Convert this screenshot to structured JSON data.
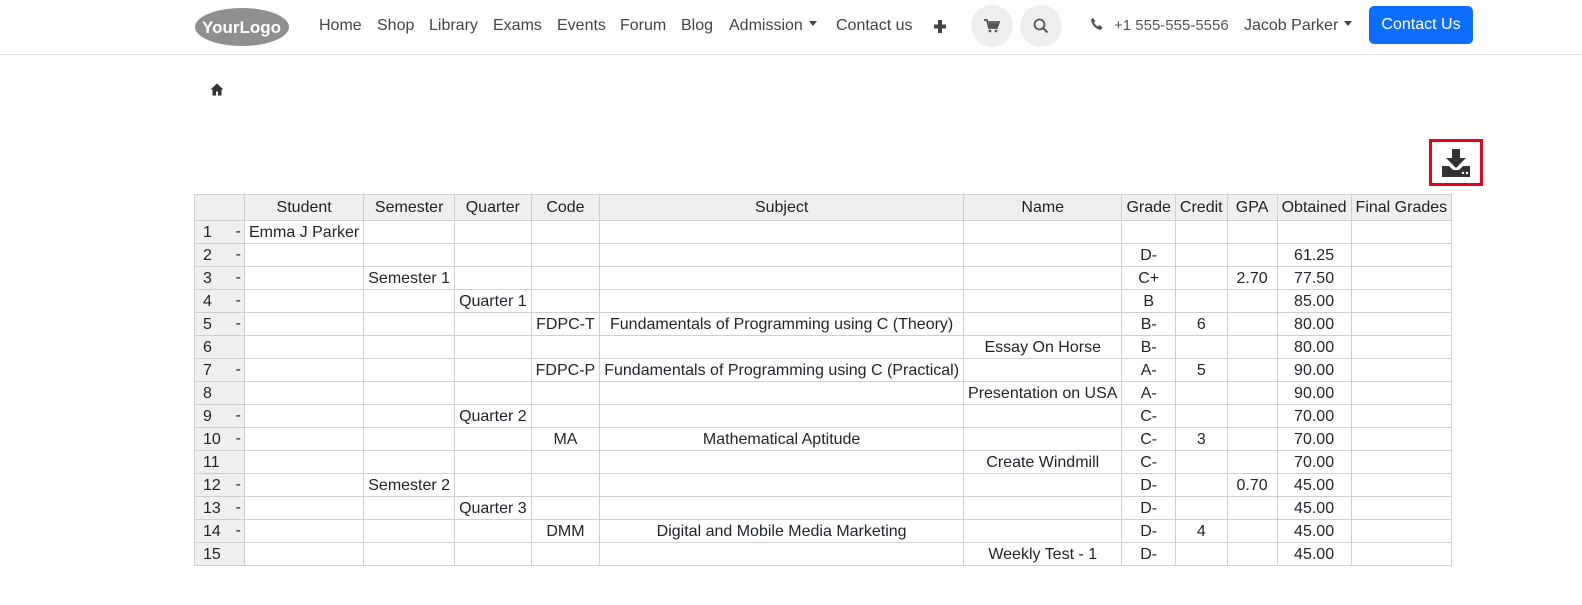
{
  "nav": {
    "logo_text": "YourLogo",
    "links": [
      "Home",
      "Shop",
      "Library",
      "Exams",
      "Events",
      "Forum",
      "Blog",
      "Admission",
      "Contact us"
    ],
    "phone": "+1 555-555-5556",
    "user": "Jacob Parker",
    "cta": "Contact Us"
  },
  "table": {
    "headers": [
      "",
      "Student",
      "Semester",
      "Quarter",
      "Code",
      "Subject",
      "Name",
      "Grade",
      "Credit",
      "GPA",
      "Obtained",
      "Final Grades"
    ],
    "rows": [
      {
        "n": "1",
        "dash": "-",
        "student": "Emma J Parker",
        "semester": "",
        "quarter": "",
        "code": "",
        "subject": "",
        "name": "",
        "grade": "",
        "credit": "",
        "gpa": "",
        "obtained": "",
        "final": ""
      },
      {
        "n": "2",
        "dash": "-",
        "student": "",
        "semester": "",
        "quarter": "",
        "code": "",
        "subject": "",
        "name": "",
        "grade": "D-",
        "credit": "",
        "gpa": "",
        "obtained": "61.25",
        "final": ""
      },
      {
        "n": "3",
        "dash": "-",
        "student": "",
        "semester": "Semester 1",
        "quarter": "",
        "code": "",
        "subject": "",
        "name": "",
        "grade": "C+",
        "credit": "",
        "gpa": "2.70",
        "obtained": "77.50",
        "final": ""
      },
      {
        "n": "4",
        "dash": "-",
        "student": "",
        "semester": "",
        "quarter": "Quarter 1",
        "code": "",
        "subject": "",
        "name": "",
        "grade": "B",
        "credit": "",
        "gpa": "",
        "obtained": "85.00",
        "final": ""
      },
      {
        "n": "5",
        "dash": "-",
        "student": "",
        "semester": "",
        "quarter": "",
        "code": "FDPC-T",
        "subject": "Fundamentals of Programming using C (Theory)",
        "name": "",
        "grade": "B-",
        "credit": "6",
        "gpa": "",
        "obtained": "80.00",
        "final": ""
      },
      {
        "n": "6",
        "dash": "",
        "student": "",
        "semester": "",
        "quarter": "",
        "code": "",
        "subject": "",
        "name": "Essay On Horse",
        "grade": "B-",
        "credit": "",
        "gpa": "",
        "obtained": "80.00",
        "final": ""
      },
      {
        "n": "7",
        "dash": "-",
        "student": "",
        "semester": "",
        "quarter": "",
        "code": "FDPC-P",
        "subject": "Fundamentals of Programming using C (Practical)",
        "name": "",
        "grade": "A-",
        "credit": "5",
        "gpa": "",
        "obtained": "90.00",
        "final": ""
      },
      {
        "n": "8",
        "dash": "",
        "student": "",
        "semester": "",
        "quarter": "",
        "code": "",
        "subject": "",
        "name": "Presentation on USA",
        "grade": "A-",
        "credit": "",
        "gpa": "",
        "obtained": "90.00",
        "final": ""
      },
      {
        "n": "9",
        "dash": "-",
        "student": "",
        "semester": "",
        "quarter": "Quarter 2",
        "code": "",
        "subject": "",
        "name": "",
        "grade": "C-",
        "credit": "",
        "gpa": "",
        "obtained": "70.00",
        "final": ""
      },
      {
        "n": "10",
        "dash": "-",
        "student": "",
        "semester": "",
        "quarter": "",
        "code": "MA",
        "subject": "Mathematical Aptitude",
        "name": "",
        "grade": "C-",
        "credit": "3",
        "gpa": "",
        "obtained": "70.00",
        "final": ""
      },
      {
        "n": "11",
        "dash": "",
        "student": "",
        "semester": "",
        "quarter": "",
        "code": "",
        "subject": "",
        "name": "Create Windmill",
        "grade": "C-",
        "credit": "",
        "gpa": "",
        "obtained": "70.00",
        "final": ""
      },
      {
        "n": "12",
        "dash": "-",
        "student": "",
        "semester": "Semester 2",
        "quarter": "",
        "code": "",
        "subject": "",
        "name": "",
        "grade": "D-",
        "credit": "",
        "gpa": "0.70",
        "obtained": "45.00",
        "final": ""
      },
      {
        "n": "13",
        "dash": "-",
        "student": "",
        "semester": "",
        "quarter": "Quarter 3",
        "code": "",
        "subject": "",
        "name": "",
        "grade": "D-",
        "credit": "",
        "gpa": "",
        "obtained": "45.00",
        "final": ""
      },
      {
        "n": "14",
        "dash": "-",
        "student": "",
        "semester": "",
        "quarter": "",
        "code": "DMM",
        "subject": "Digital and Mobile Media Marketing",
        "name": "",
        "grade": "D-",
        "credit": "4",
        "gpa": "",
        "obtained": "45.00",
        "final": ""
      },
      {
        "n": "15",
        "dash": "",
        "student": "",
        "semester": "",
        "quarter": "",
        "code": "",
        "subject": "",
        "name": "Weekly Test - 1",
        "grade": "D-",
        "credit": "",
        "gpa": "",
        "obtained": "45.00",
        "final": ""
      }
    ]
  },
  "icons": {
    "plus": "plus-icon",
    "cart": "cart-icon",
    "search": "search-icon",
    "phone": "phone-icon",
    "home": "home-icon",
    "download": "download-icon"
  },
  "colors": {
    "primary": "#0d6efd",
    "highlight": "#e8001c",
    "header_bg": "#efefef"
  }
}
